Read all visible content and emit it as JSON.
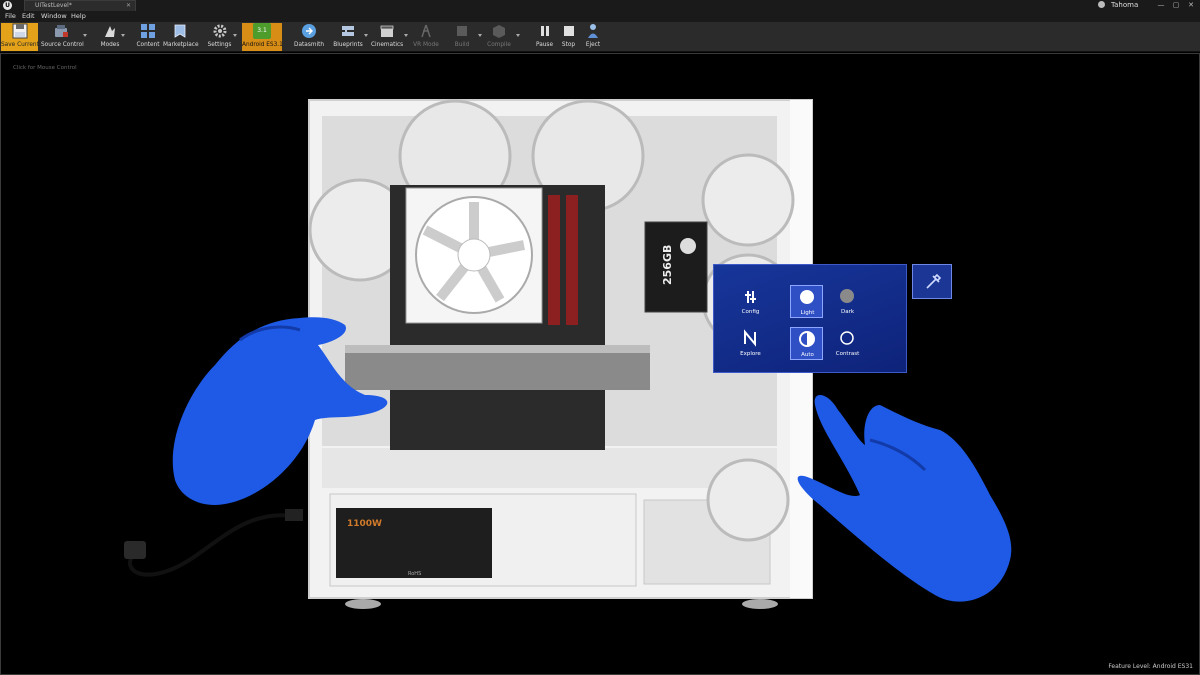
{
  "window": {
    "tab_title": "UITestLevel*",
    "account_name": "Tahoma"
  },
  "menu": [
    "File",
    "Edit",
    "Window",
    "Help"
  ],
  "toolbar": {
    "save_current": "Save Current",
    "source_control": "Source Control",
    "modes": "Modes",
    "content": "Content",
    "marketplace": "Marketplace",
    "settings": "Settings",
    "android_badge": "3.1",
    "android_es31": "Android ES3.1",
    "datasmith": "Datasmith",
    "blueprints": "Blueprints",
    "cinematics": "Cinematics",
    "vr_mode": "VR Mode",
    "build": "Build",
    "compile": "Compile",
    "pause": "Pause",
    "stop": "Stop",
    "eject": "Eject"
  },
  "viewport": {
    "hint": "Click for Mouse Control",
    "feature_level": "Feature Level:  Android ES31"
  },
  "scene": {
    "ssd_capacity": "256GB",
    "psu_wattage": "1100W",
    "psu_mark": "RoHS"
  },
  "vr_menu": {
    "items": [
      {
        "label": "Config",
        "icon": "config-icon"
      },
      {
        "label": "Light",
        "icon": "light-theme-icon"
      },
      {
        "label": "Dark",
        "icon": "dark-theme-icon"
      },
      {
        "label": "Explore",
        "icon": "explore-icon"
      },
      {
        "label": "Auto",
        "icon": "auto-theme-icon"
      },
      {
        "label": "Contrast",
        "icon": "contrast-theme-icon"
      }
    ],
    "selected": [
      "Light",
      "Auto"
    ],
    "pin_icon": "pin-icon"
  },
  "colors": {
    "accent_save": "#e3a21a",
    "vr_panel": "#142f8c",
    "hands": "#1e5ae6"
  }
}
